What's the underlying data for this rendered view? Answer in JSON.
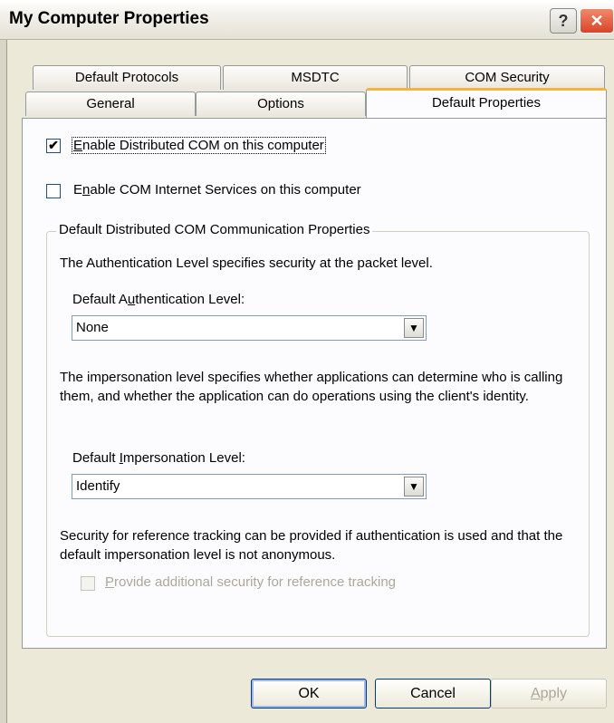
{
  "window": {
    "title": "My Computer Properties",
    "help_glyph": "?",
    "close_glyph": "✕"
  },
  "tabs": {
    "row1": [
      "Default Protocols",
      "MSDTC",
      "COM Security"
    ],
    "row2": [
      "General",
      "Options",
      "Default Properties"
    ],
    "active": "Default Properties"
  },
  "options": {
    "enable_dcom": {
      "label_prefix": "",
      "label_key": "E",
      "label_rest": "nable Distributed COM on this computer",
      "checked": true
    },
    "enable_cis": {
      "label_prefix": "E",
      "label_key": "n",
      "label_rest": "able COM Internet Services on this computer",
      "checked": false
    }
  },
  "group": {
    "title": "Default Distributed COM Communication Properties",
    "auth_desc": "The Authentication Level specifies security at the packet level.",
    "auth_label_prefix": "Default A",
    "auth_label_key": "u",
    "auth_label_rest": "thentication Level:",
    "auth_value": "None",
    "imp_desc": "The impersonation level specifies whether applications can determine who is calling them, and whether the application can do operations using the client's identity.",
    "imp_label_prefix": "Default ",
    "imp_label_key": "I",
    "imp_label_rest": "mpersonation Level:",
    "imp_value": "Identify",
    "ref_desc": "Security for reference tracking can be provided if authentication is used and that the default impersonation level is not anonymous.",
    "ref_check_key": "P",
    "ref_check_rest": "rovide additional security for reference tracking",
    "ref_checked": false
  },
  "buttons": {
    "ok": "OK",
    "cancel": "Cancel",
    "apply_key": "A",
    "apply_rest": "pply"
  },
  "colors": {
    "accent_tab": "#f7b13e",
    "close": "#d8432a"
  }
}
